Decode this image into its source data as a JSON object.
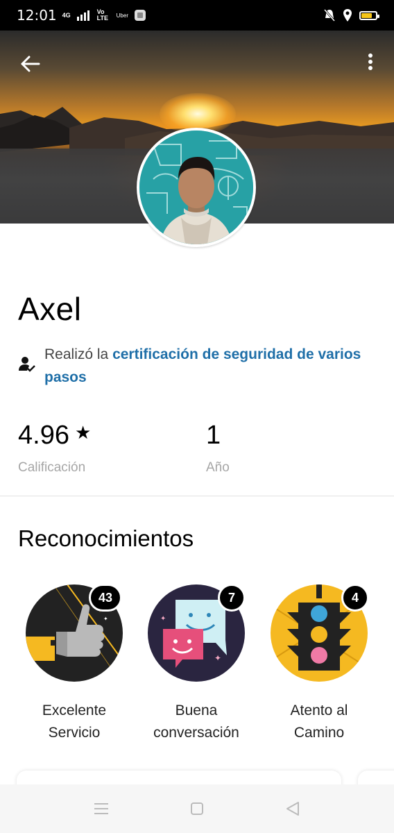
{
  "status_bar": {
    "time": "12:01",
    "network_top": "4G",
    "network_volte": "Vo LTE",
    "small_label": "Uber",
    "icons": [
      "signal-icon",
      "sim-app-icon",
      "bell-off-icon",
      "location-icon",
      "battery-icon"
    ]
  },
  "profile": {
    "name": "Axel",
    "certification_prefix": "Realizó la ",
    "certification_link": "certificación de seguridad de varios pasos",
    "rating_value": "4.96",
    "rating_label": "Calificación",
    "years_value": "1",
    "years_label": "Año"
  },
  "recognitions": {
    "title": "Reconocimientos",
    "items": [
      {
        "label": "Excelente\nServicio",
        "count": "43",
        "icon": "thumbs-up-icon",
        "color": "#222222"
      },
      {
        "label": "Buena\nconversación",
        "count": "7",
        "icon": "chat-bubbles-icon",
        "color": "#2a2540"
      },
      {
        "label": "Atento al\nCamino",
        "count": "4",
        "icon": "traffic-light-icon",
        "color": "#f5b921"
      }
    ]
  },
  "nav": {
    "buttons": [
      "menu-icon",
      "home-square-icon",
      "back-triangle-icon"
    ]
  },
  "colors": {
    "link": "#1f6fa8",
    "muted": "#a6a6a6",
    "accent_yellow": "#f5b921"
  }
}
